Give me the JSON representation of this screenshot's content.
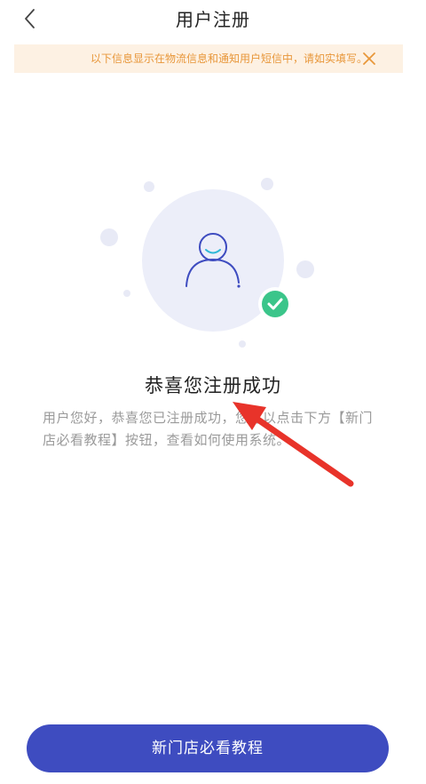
{
  "header": {
    "title": "用户注册",
    "back_icon": "chevron-left-icon"
  },
  "notice": {
    "text": "以下信息显示在物流信息和通知用户短信中，请如实填写。",
    "close_icon": "close-icon",
    "color": "#e8973a",
    "background": "#fdf1e3"
  },
  "success": {
    "title": "恭喜您注册成功",
    "description": "用户您好，恭喜您已注册成功，您可以点击下方【新门店必看教程】按钮，查看如何使用系统。",
    "avatar_icon": "user-avatar-icon",
    "check_icon": "check-badge-icon",
    "check_color": "#3bc58a"
  },
  "button": {
    "label": "新门店必看教程",
    "color": "#3e4cc0"
  }
}
